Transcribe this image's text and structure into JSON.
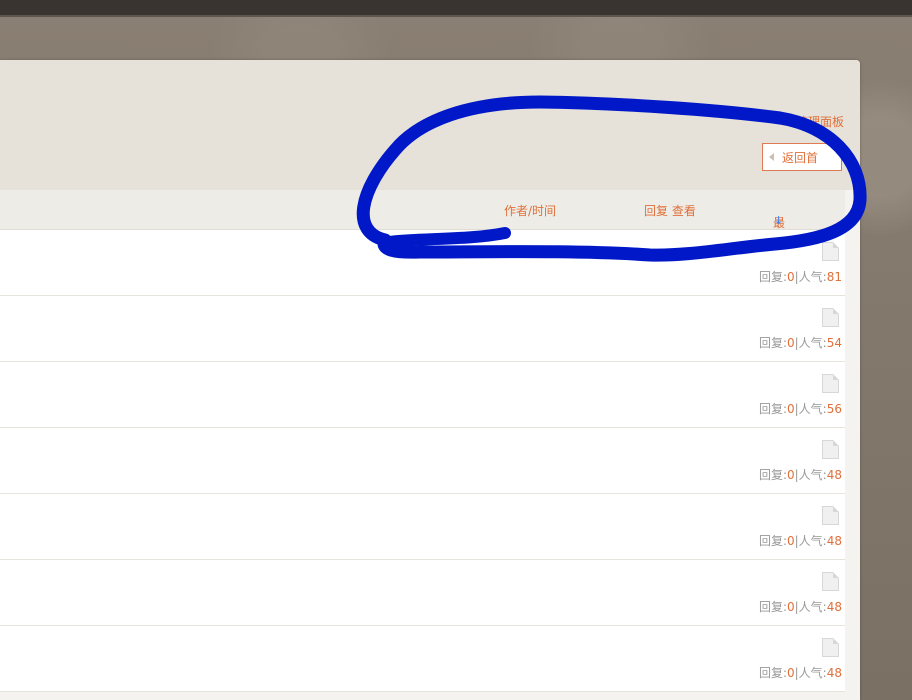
{
  "header": {
    "admin_panel": "管理面板",
    "back_button": "返回首"
  },
  "columns": {
    "author_time": "作者/时间",
    "reply_view": "回复 查看",
    "last_post": "最后发表",
    "sort_arrow": "↓"
  },
  "rows": [
    {
      "reply_label": "回复:",
      "replies": "0",
      "sep": "|",
      "views_label": "人气:",
      "views": "81"
    },
    {
      "reply_label": "回复:",
      "replies": "0",
      "sep": "|",
      "views_label": "人气:",
      "views": "54"
    },
    {
      "reply_label": "回复:",
      "replies": "0",
      "sep": "|",
      "views_label": "人气:",
      "views": "56"
    },
    {
      "reply_label": "回复:",
      "replies": "0",
      "sep": "|",
      "views_label": "人气:",
      "views": "48"
    },
    {
      "reply_label": "回复:",
      "replies": "0",
      "sep": "|",
      "views_label": "人气:",
      "views": "48"
    },
    {
      "reply_label": "回复:",
      "replies": "0",
      "sep": "|",
      "views_label": "人气:",
      "views": "48"
    },
    {
      "reply_label": "回复:",
      "replies": "0",
      "sep": "|",
      "views_label": "人气:",
      "views": "48"
    }
  ],
  "icons": {
    "row_icon": "document-icon",
    "back_icon": "caret-left-icon"
  },
  "colors": {
    "accent": "#e0703a",
    "annotation": "#0018c8"
  }
}
